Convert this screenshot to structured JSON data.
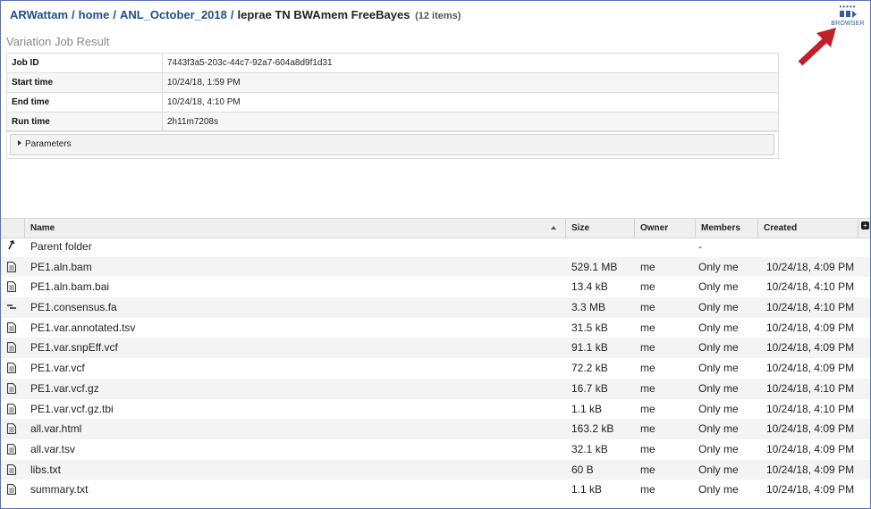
{
  "breadcrumb": {
    "parts": [
      "ARWattam",
      "home",
      "ANL_October_2018"
    ],
    "current": "leprae TN BWAmem FreeBayes",
    "count": "(12 items)",
    "separator": "/"
  },
  "browser_button": {
    "label": "BROWSER",
    "icon": "browser-icon"
  },
  "job_result": {
    "title": "Variation Job Result",
    "rows": [
      {
        "key": "Job ID",
        "value": "7443f3a5-203c-44c7-92a7-604a8d9f1d31"
      },
      {
        "key": "Start time",
        "value": "10/24/18, 1:59 PM"
      },
      {
        "key": "End time",
        "value": "10/24/18, 4:10 PM"
      },
      {
        "key": "Run time",
        "value": "2h11m7208s"
      }
    ],
    "parameters_label": "Parameters"
  },
  "file_grid": {
    "columns": {
      "name": "Name",
      "size": "Size",
      "owner": "Owner",
      "members": "Members",
      "created": "Created"
    },
    "parent": {
      "name": "Parent folder",
      "members": "-"
    },
    "files": [
      {
        "icon": "file-icon",
        "name": "PE1.aln.bam",
        "size": "529.1 MB",
        "owner": "me",
        "members": "Only me",
        "created": "10/24/18, 4:09 PM"
      },
      {
        "icon": "file-icon",
        "name": "PE1.aln.bam.bai",
        "size": "13.4 kB",
        "owner": "me",
        "members": "Only me",
        "created": "10/24/18, 4:10 PM"
      },
      {
        "icon": "contigs-icon",
        "name": "PE1.consensus.fa",
        "size": "3.3 MB",
        "owner": "me",
        "members": "Only me",
        "created": "10/24/18, 4:10 PM"
      },
      {
        "icon": "file-icon",
        "name": "PE1.var.annotated.tsv",
        "size": "31.5 kB",
        "owner": "me",
        "members": "Only me",
        "created": "10/24/18, 4:09 PM"
      },
      {
        "icon": "file-icon",
        "name": "PE1.var.snpEff.vcf",
        "size": "91.1 kB",
        "owner": "me",
        "members": "Only me",
        "created": "10/24/18, 4:09 PM"
      },
      {
        "icon": "file-icon",
        "name": "PE1.var.vcf",
        "size": "72.2 kB",
        "owner": "me",
        "members": "Only me",
        "created": "10/24/18, 4:09 PM"
      },
      {
        "icon": "file-icon",
        "name": "PE1.var.vcf.gz",
        "size": "16.7 kB",
        "owner": "me",
        "members": "Only me",
        "created": "10/24/18, 4:10 PM"
      },
      {
        "icon": "file-icon",
        "name": "PE1.var.vcf.gz.tbi",
        "size": "1.1 kB",
        "owner": "me",
        "members": "Only me",
        "created": "10/24/18, 4:10 PM"
      },
      {
        "icon": "file-icon",
        "name": "all.var.html",
        "size": "163.2 kB",
        "owner": "me",
        "members": "Only me",
        "created": "10/24/18, 4:09 PM"
      },
      {
        "icon": "file-icon",
        "name": "all.var.tsv",
        "size": "32.1 kB",
        "owner": "me",
        "members": "Only me",
        "created": "10/24/18, 4:09 PM"
      },
      {
        "icon": "file-icon",
        "name": "libs.txt",
        "size": "60 B",
        "owner": "me",
        "members": "Only me",
        "created": "10/24/18, 4:09 PM"
      },
      {
        "icon": "file-icon",
        "name": "summary.txt",
        "size": "1.1 kB",
        "owner": "me",
        "members": "Only me",
        "created": "10/24/18, 4:09 PM"
      }
    ]
  },
  "colors": {
    "link": "#1f4e8c",
    "accent_arrow": "#c0202a",
    "frame": "#5c6fb1"
  }
}
